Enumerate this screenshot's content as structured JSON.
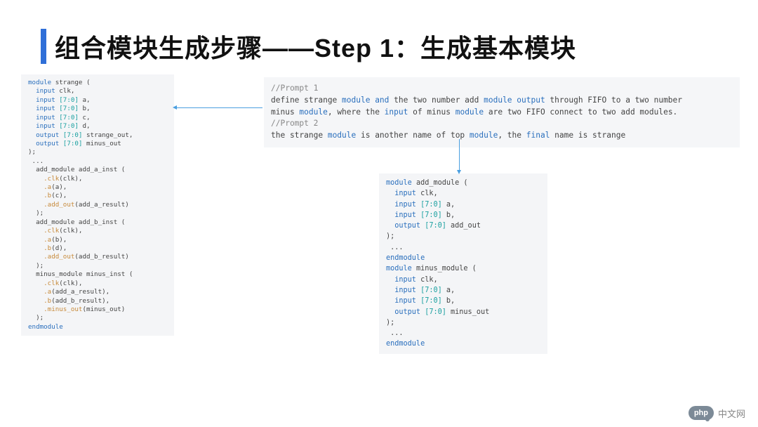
{
  "title": "组合模块生成步骤——Step 1：生成基本模块",
  "left_code": [
    {
      "keyword": "module",
      "tail": " strange ("
    },
    {
      "keyword": "  input",
      "tail": " clk,"
    },
    {
      "keyword": "  input",
      "range": " [7:0]",
      "tail": " a,"
    },
    {
      "keyword": "  input",
      "range": " [7:0]",
      "tail": " b,"
    },
    {
      "keyword": "  input",
      "range": " [7:0]",
      "tail": " c,"
    },
    {
      "keyword": "  input",
      "range": " [7:0]",
      "tail": " d,"
    },
    {
      "keyword": "  output",
      "range": " [7:0]",
      "tail": " strange_out,"
    },
    {
      "keyword": "  output",
      "range": " [7:0]",
      "tail": " minus_out"
    },
    {
      "plain": ");"
    },
    {
      "plain": " ..."
    },
    {
      "plain": ""
    },
    {
      "plain": "  add_module add_a_inst ("
    },
    {
      "call": "    .clk",
      "arg": "(clk),"
    },
    {
      "call": "    .a",
      "arg": "(a),"
    },
    {
      "call": "    .b",
      "arg": "(c),"
    },
    {
      "call": "    .add_out",
      "arg": "(add_a_result)"
    },
    {
      "plain": "  );"
    },
    {
      "plain": ""
    },
    {
      "plain": "  add_module add_b_inst ("
    },
    {
      "call": "    .clk",
      "arg": "(clk),"
    },
    {
      "call": "    .a",
      "arg": "(b),"
    },
    {
      "call": "    .b",
      "arg": "(d),"
    },
    {
      "call": "    .add_out",
      "arg": "(add_b_result)"
    },
    {
      "plain": "  );"
    },
    {
      "plain": ""
    },
    {
      "plain": "  minus_module minus_inst ("
    },
    {
      "call": "    .clk",
      "arg": "(clk),"
    },
    {
      "call": "    .a",
      "arg": "(add_a_result),"
    },
    {
      "call": "    .b",
      "arg": "(add_b_result),"
    },
    {
      "call": "    .minus_out",
      "arg": "(minus_out)"
    },
    {
      "plain": "  );"
    },
    {
      "end": "endmodule"
    }
  ],
  "prompt": {
    "c1": "//Prompt 1",
    "l1_a": "define strange ",
    "l1_m1": "module and",
    "l1_b": " the two number add ",
    "l1_m2": "module output",
    "l1_c": " through FIFO to a two number",
    "l2_a": "minus ",
    "l2_m1": "module",
    "l2_b": ", where the ",
    "l2_m2": "input",
    "l2_c": " of minus ",
    "l2_m3": "module",
    "l2_d": " are two FIFO connect to two add modules.",
    "c2": "//Prompt 2",
    "l3_a": "the strange ",
    "l3_m1": "module",
    "l3_b": " is another name of top ",
    "l3_m2": "module",
    "l3_c": ", the ",
    "l3_m3": "final",
    "l3_d": " name is strange"
  },
  "right_code": [
    {
      "keyword": "module",
      "tail": " add_module ("
    },
    {
      "keyword": "  input",
      "tail": " clk,"
    },
    {
      "keyword": "  input",
      "range": " [7:0]",
      "tail": " a,"
    },
    {
      "keyword": "  input",
      "range": " [7:0]",
      "tail": " b,"
    },
    {
      "keyword": "  output",
      "range": " [7:0]",
      "tail": " add_out"
    },
    {
      "plain": ");"
    },
    {
      "plain": " ..."
    },
    {
      "end": "endmodule"
    },
    {
      "plain": ""
    },
    {
      "keyword": "module",
      "tail": " minus_module ("
    },
    {
      "keyword": "  input",
      "tail": " clk,"
    },
    {
      "keyword": "  input",
      "range": " [7:0]",
      "tail": " a,"
    },
    {
      "keyword": "  input",
      "range": " [7:0]",
      "tail": " b,"
    },
    {
      "keyword": "  output",
      "range": " [7:0]",
      "tail": " minus_out"
    },
    {
      "plain": ");"
    },
    {
      "plain": " ..."
    },
    {
      "end": "endmodule"
    }
  ],
  "watermark": {
    "badge": "php",
    "text": "中文网"
  }
}
